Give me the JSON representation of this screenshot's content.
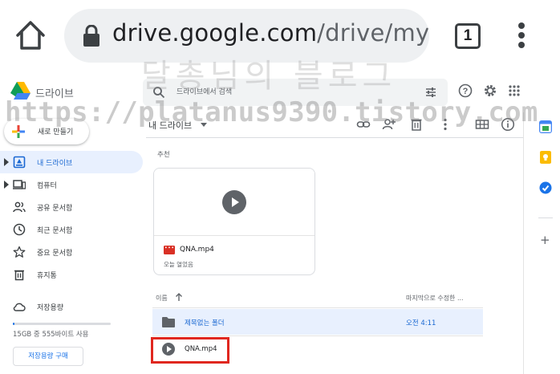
{
  "browser": {
    "url_host": "drive.google.com",
    "url_path": "/drive/my·",
    "tab_count": "1"
  },
  "watermarks": {
    "blog_name": "달총님의 블로그",
    "blog_url": "https://platanus9390.tistory.com"
  },
  "drive": {
    "app_title": "드라이브",
    "search_placeholder": "드라이브에서 검색"
  },
  "sidebar": {
    "new_label": "새로 만들기",
    "items": [
      {
        "label": "내 드라이브",
        "icon": "my-drive-icon",
        "active": true
      },
      {
        "label": "컴퓨터",
        "icon": "computer-icon"
      },
      {
        "label": "공유 문서함",
        "icon": "shared-icon"
      },
      {
        "label": "최근 문서함",
        "icon": "recent-icon"
      },
      {
        "label": "중요 문서함",
        "icon": "star-icon"
      },
      {
        "label": "휴지통",
        "icon": "trash-icon"
      },
      {
        "label": "저장용량",
        "icon": "cloud-icon"
      }
    ],
    "storage_used_fraction": 0.02,
    "storage_text": "15GB 중 555바이트 사용",
    "buy_storage_label": "저장용량 구매"
  },
  "main": {
    "location_title": "내 드라이브",
    "suggested_label": "추천",
    "suggested_card": {
      "file_name": "QNA.mp4",
      "subtitle": "오늘 열었음"
    },
    "columns": {
      "name": "이름",
      "modified": "마지막으로 수정한 ..."
    },
    "rows": [
      {
        "name": "제목없는 폴더",
        "modified": "오전 4:11",
        "type": "folder"
      },
      {
        "name": "QNA.mp4",
        "modified": "",
        "type": "video"
      }
    ]
  },
  "colors": {
    "accent_blue": "#1a73e8",
    "selected_bg": "#e8f0fe",
    "highlight_red": "#e0271f"
  }
}
